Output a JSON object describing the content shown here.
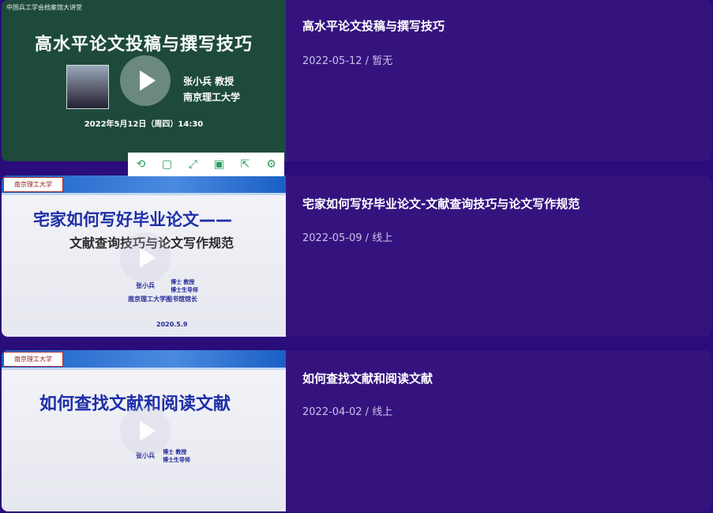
{
  "items": [
    {
      "title": "高水平论文投稿与撰写技巧",
      "meta": "2022-05-12 / 暂无",
      "thumb": {
        "org": "中国兵工学会档案馆大讲堂",
        "heading": "高水平论文投稿与撰写技巧",
        "speaker_line1": "张小兵 教授",
        "speaker_line2": "南京理工大学",
        "date": "2022年5月12日（周四）14:30"
      }
    },
    {
      "title": "宅家如何写好毕业论文-文献查询技巧与论文写作规范",
      "meta": "2022-05-09 / 线上",
      "thumb": {
        "logo": "南京理工大学",
        "heading1": "宅家如何写好毕业论文——",
        "heading2": "文献查询技巧与论文写作规范",
        "speaker": "张小兵",
        "titles": "博士  教授",
        "titles2": "博士生导师",
        "affiliation": "南京理工大学图书馆馆长",
        "date": "2020.5.9"
      }
    },
    {
      "title": "如何查找文献和阅读文献",
      "meta": "2022-04-02 / 线上",
      "thumb": {
        "logo": "南京理工大学",
        "heading": "如何查找文献和阅读文献",
        "speaker": "张小兵",
        "titles": "博士  教授",
        "titles2": "博士生导师"
      }
    }
  ],
  "player_toolbar": {
    "icons": [
      "replay-icon",
      "copy-icon",
      "fullscreen-icon",
      "save-icon",
      "share-icon",
      "settings-icon"
    ],
    "accent": "#2a9d5c"
  },
  "colors": {
    "background": "#2a0c7a",
    "card": "#34137f"
  }
}
